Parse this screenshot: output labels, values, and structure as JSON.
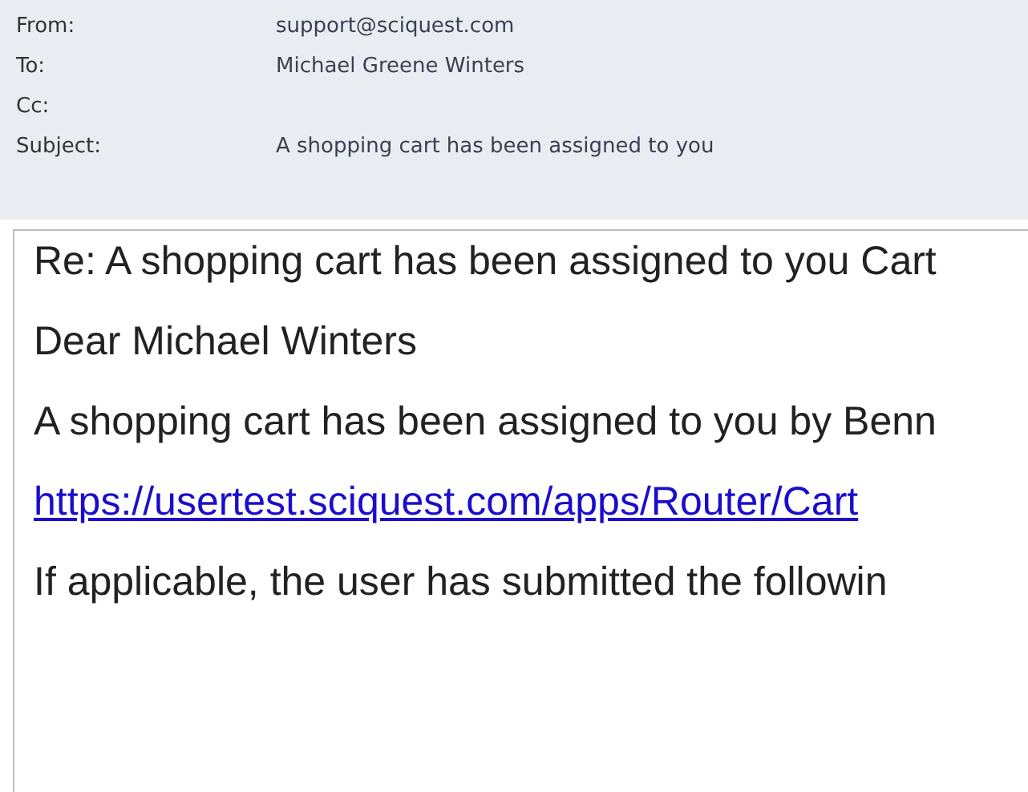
{
  "header": [
    {
      "label": "From:",
      "value": "support@sciquest.com"
    },
    {
      "label": "To:",
      "value": "Michael Greene Winters"
    },
    {
      "label": "Cc:"
    },
    {
      "label": "Subject:",
      "value": "A shopping cart has been assigned to you"
    }
  ],
  "body": [
    {
      "kind": "text",
      "text": "Re: A shopping cart has been assigned to you Cart"
    },
    {
      "kind": "text",
      "text": "Dear Michael Winters"
    },
    {
      "kind": "text",
      "text": "A shopping cart has been assigned to you by Benn"
    },
    {
      "kind": "link",
      "text": "https://usertest.sciquest.com/apps/Router/Cart"
    },
    {
      "kind": "text",
      "text": "If applicable, the user has submitted the followin"
    }
  ]
}
